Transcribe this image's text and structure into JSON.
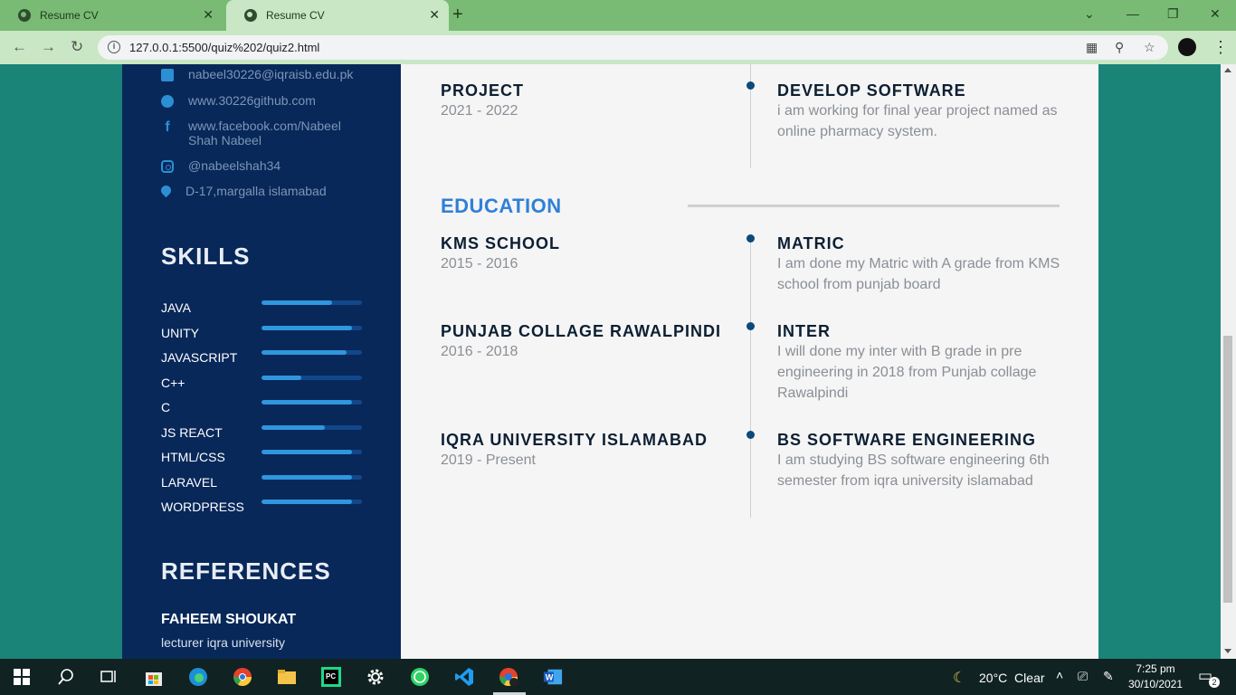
{
  "browser": {
    "tabs": [
      {
        "title": "Resume CV",
        "active": false
      },
      {
        "title": "Resume CV",
        "active": true
      }
    ],
    "url": "127.0.0.1:5500/quiz%202/quiz2.html"
  },
  "contact": {
    "email": "nabeel30226@iqraisb.edu.pk",
    "website": "www.30226github.com",
    "facebook": "www.facebook.com/Nabeel Shah Nabeel",
    "instagram": "@nabeelshah34",
    "location": "D-17,margalla islamabad"
  },
  "skills": {
    "heading": "SKILLS",
    "items": [
      {
        "name": "JAVA",
        "level": 0.7
      },
      {
        "name": "UNITY",
        "level": 0.9
      },
      {
        "name": "JAVASCRIPT",
        "level": 0.85
      },
      {
        "name": "C++",
        "level": 0.4
      },
      {
        "name": "C",
        "level": 0.9
      },
      {
        "name": "JS REACT",
        "level": 0.63
      },
      {
        "name": "HTML/CSS",
        "level": 0.9
      },
      {
        "name": "LARAVEL",
        "level": 0.9
      },
      {
        "name": "WORDPRESS",
        "level": 0.9
      }
    ]
  },
  "references": {
    "heading": "REFERENCES",
    "name": "FAHEEM SHOUKAT",
    "role": "lecturer iqra university"
  },
  "project": {
    "title": "PROJECT",
    "years": "2021 - 2022",
    "right_title": "DEVELOP SOFTWARE",
    "desc": "i am working for final year project named as online pharmacy system."
  },
  "education": {
    "heading": "EDUCATION",
    "items": [
      {
        "school": "KMS SCHOOL",
        "years": "2015 - 2016",
        "degree": "MATRIC",
        "desc": "I am done my Matric with A grade from KMS school from punjab board"
      },
      {
        "school": "PUNJAB COLLAGE RAWALPINDI",
        "years": "2016 - 2018",
        "degree": "INTER",
        "desc": "I will done my inter with B grade in pre engineering in 2018 from Punjab collage Rawalpindi"
      },
      {
        "school": "IQRA UNIVERSITY ISLAMABAD",
        "years": "2019 - Present",
        "degree": "BS SOFTWARE ENGINEERING",
        "desc": "I am studying BS software engineering 6th semester from iqra university islamabad"
      }
    ]
  },
  "taskbar": {
    "weather": "20°C  Clear",
    "time": "7:25 pm",
    "date": "30/10/2021",
    "notifications": "2"
  },
  "colors": {
    "sidebar": "#08285a",
    "accent": "#2f80d6",
    "skill_fill": "#2f97dd",
    "page_bg": "#1a8478"
  }
}
